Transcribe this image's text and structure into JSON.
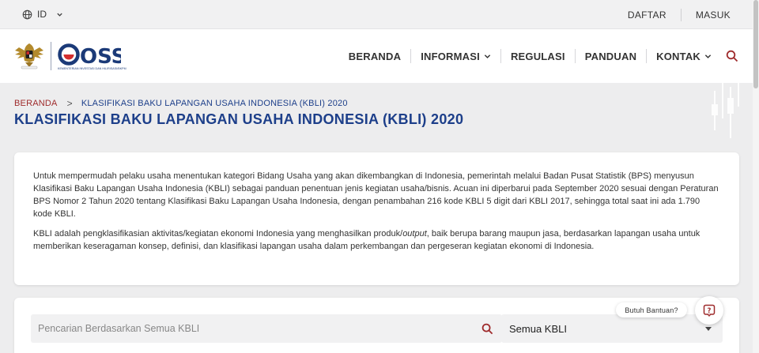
{
  "topbar": {
    "language": "ID",
    "links": [
      "DAFTAR",
      "MASUK"
    ]
  },
  "logo": {
    "name": "OSS",
    "subtitle": "KEMENTERIAN INVESTASI DAN HILIRISASI/BKPM"
  },
  "nav": {
    "items": [
      {
        "label": "BERANDA",
        "dropdown": false
      },
      {
        "label": "INFORMASI",
        "dropdown": true
      },
      {
        "label": "REGULASI",
        "dropdown": false
      },
      {
        "label": "PANDUAN",
        "dropdown": false
      },
      {
        "label": "KONTAK",
        "dropdown": true
      }
    ]
  },
  "breadcrumb": {
    "home": "BERANDA",
    "separator": ">",
    "current": "KLASIFIKASI BAKU LAPANGAN USAHA INDONESIA (KBLI) 2020"
  },
  "page": {
    "title": "KLASIFIKASI BAKU LAPANGAN USAHA INDONESIA (KBLI) 2020"
  },
  "intro": {
    "paragraph1": "Untuk mempermudah pelaku usaha menentukan kategori Bidang Usaha yang akan dikembangkan di Indonesia, pemerintah melalui Badan Pusat Statistik (BPS) menyusun Klasifikasi Baku Lapangan Usaha Indonesia (KBLI) sebagai panduan penentuan jenis kegiatan usaha/bisnis. Acuan ini diperbarui pada September 2020 sesuai dengan Peraturan BPS Nomor 2 Tahun 2020 tentang Klasifikasi Baku Lapangan Usaha Indonesia, dengan penambahan 216 kode KBLI 5 digit dari KBLI 2017, sehingga total saat ini ada 1.790 kode KBLI.",
    "paragraph2_before": "KBLI adalah pengklasifikasian aktivitas/kegiatan ekonomi Indonesia yang menghasilkan produk/",
    "paragraph2_em": "output",
    "paragraph2_after": ", baik berupa barang maupun jasa, berdasarkan lapangan usaha untuk memberikan keseragaman konsep, definisi, dan klasifikasi lapangan usaha dalam perkembangan dan pergeseran kegiatan ekonomi di Indonesia."
  },
  "search": {
    "placeholder": "Pencarian Berdasarkan Semua KBLI",
    "value": "",
    "filter_selected": "Semua KBLI"
  },
  "help": {
    "label": "Butuh Bantuan?"
  },
  "colors": {
    "brand_blue": "#1d3f8a",
    "brand_red": "#9e2a2b",
    "logo_red": "#d32f2f"
  },
  "icons": {
    "language": "globe-icon",
    "dropdown": "chevron-down-icon",
    "search": "search-icon",
    "help": "question-icon"
  }
}
